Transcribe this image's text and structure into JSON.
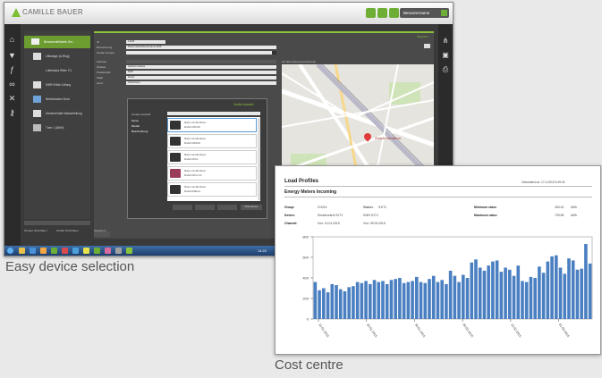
{
  "app": {
    "logo_text": "CAMILLE BAUER",
    "user_label": "Benutzername",
    "tree": {
      "root": "Benutzerdefinierte Ger...",
      "items": [
        "Liftanlage (A-Ring)",
        "Lufteinlass Ritter 7/1",
        "KWR+Kälte Lüftung",
        "Nebenkosten Nord",
        "Gewerbehalle Wasserleitung",
        "Turm 1 (ANW)"
      ]
    },
    "form": {
      "section_label": "Übersicht",
      "labels": [
        "ID",
        "Bezeichnung",
        "Geräte Gruppe",
        "Adresse",
        "Strasse",
        "Postleitzahl",
        "Stadt",
        "Land"
      ],
      "values": [
        "12345",
        "Neues Gerät Ebenenname 2019",
        "",
        "",
        "Hardturmstrasse",
        "8005",
        "Zürich",
        "Switzerland"
      ],
      "map_title": "Ort über Adresse bestimmen",
      "map_place": "Zürich Hardturm"
    },
    "modal": {
      "title": "Geräte Auswahl",
      "filters": [
        "Geräte Auswahl",
        "Name",
        "Modell",
        "Beschreibung"
      ],
      "devices": [
        {
          "l1": "Marke     Camille Bauer",
          "l2": "Modell   AM1000"
        },
        {
          "l1": "Marke     Camille Bauer",
          "l2": "Modell   AM3000"
        },
        {
          "l1": "Marke     Camille Bauer",
          "l2": "Modell   AP4xx"
        },
        {
          "l1": "Marke     Camille Bauer",
          "l2": "Modell   APlus-OC"
        },
        {
          "l1": "Marke     Camille Bauer",
          "l2": "Modell   DME4xx"
        }
      ],
      "footer_button": "Übernehmen"
    },
    "bottom_buttons": [
      "Gruppe hinzufügen",
      "Geräte hinzufügen",
      "Speichern"
    ],
    "clock": "14:22"
  },
  "captions": {
    "left": "Easy device selection",
    "right": "Cost centre"
  },
  "report": {
    "title": "Load Profiles",
    "generated": "Generated on: 17.4.2015 3:49:32",
    "subtitle": "Energy Meters Incoming",
    "rows": [
      {
        "label": "Group:",
        "value": "CH214",
        "label2": "Station:",
        "value2": "S1/T1",
        "label3": "Minimum value:",
        "value3": "263.42",
        "unit": "kWh"
      },
      {
        "label": "Device:",
        "value": "Smartcontrol S1T1",
        "label2": "",
        "value2": "KWH S1T1",
        "label3": "Maximum value:",
        "value3": "729.89",
        "unit": "kWh"
      },
      {
        "label": "Channel:",
        "value": "Von: 10.01.2015",
        "label2": "",
        "value2": "Von: 09.03.2015",
        "label3": "",
        "value3": "",
        "unit": ""
      }
    ]
  },
  "chart_data": {
    "type": "bar",
    "color": "#4a7fc1",
    "ylim": [
      0,
      800
    ],
    "yticks": [
      "0",
      "200",
      "400",
      "600",
      "800"
    ],
    "xticks": [
      "10.01.2015",
      "20.01.2015",
      "30.01.2015",
      "09.02.2015",
      "19.02.2015",
      "01.03.2015"
    ],
    "values": [
      360,
      280,
      300,
      260,
      340,
      330,
      290,
      270,
      310,
      320,
      360,
      350,
      370,
      340,
      380,
      360,
      370,
      340,
      380,
      390,
      400,
      350,
      360,
      370,
      410,
      360,
      350,
      390,
      420,
      360,
      380,
      340,
      470,
      420,
      360,
      430,
      400,
      550,
      580,
      500,
      470,
      520,
      560,
      570,
      460,
      500,
      480,
      420,
      520,
      370,
      360,
      410,
      400,
      510,
      450,
      560,
      610,
      620,
      500,
      440,
      590,
      570,
      480,
      490,
      730,
      540
    ]
  }
}
